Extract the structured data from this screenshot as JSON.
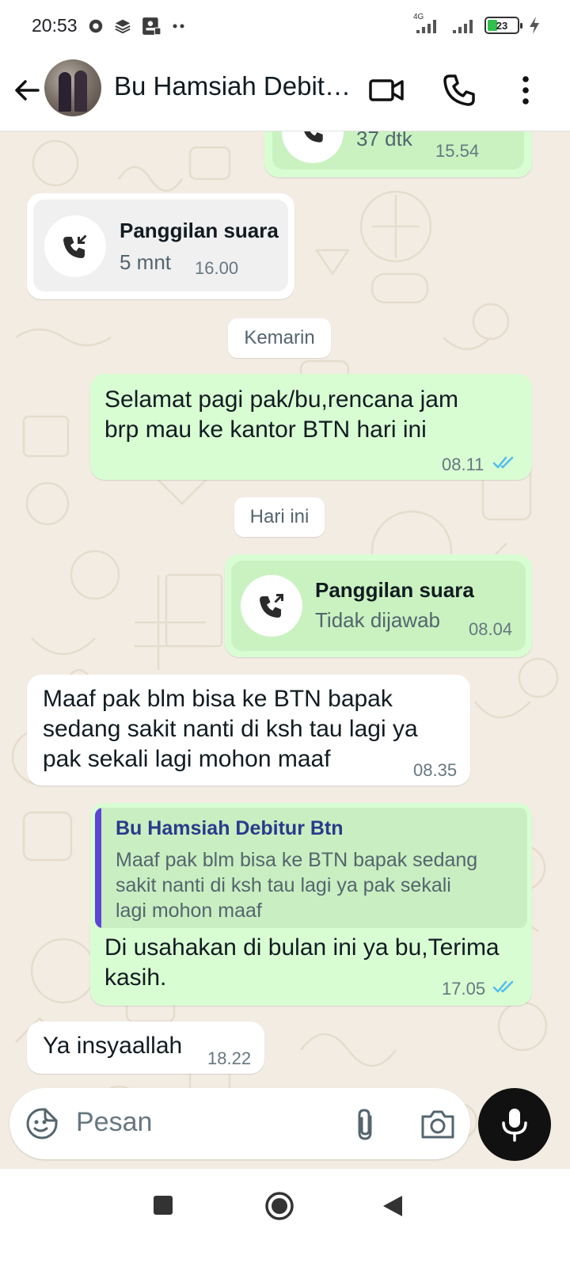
{
  "status_bar": {
    "time": "20:53",
    "network": "4G",
    "battery": "23"
  },
  "header": {
    "contact_name": "Bu Hamsiah Debit…",
    "icons": [
      "back-arrow-icon",
      "video-call-icon",
      "voice-call-icon",
      "more-vert-icon"
    ]
  },
  "messages": {
    "m0": {
      "duration": "37 dtk",
      "time": "15.54"
    },
    "m1": {
      "title": "Panggilan suara",
      "subtitle": "5 mnt",
      "time": "16.00"
    },
    "date1": "Kemarin",
    "m2": {
      "line1": "Selamat pagi pak/bu,rencana jam",
      "line2": "brp mau ke kantor BTN hari ini",
      "time": "08.11"
    },
    "date2": "Hari ini",
    "m3": {
      "title": "Panggilan suara",
      "subtitle": "Tidak dijawab",
      "time": "08.04"
    },
    "m4": {
      "line1": "Maaf pak blm bisa ke BTN bapak",
      "line2": "sedang sakit nanti di ksh tau lagi ya",
      "line3": "pak sekali lagi mohon maaf",
      "time": "08.35"
    },
    "m5": {
      "quote_author": "Bu Hamsiah Debitur Btn",
      "quote_line1": "Maaf pak blm bisa ke BTN bapak sedang",
      "quote_line2": "sakit nanti di ksh tau lagi ya pak sekali",
      "quote_line3": "lagi mohon maaf",
      "line1": "Di usahakan di bulan ini ya bu,Terima",
      "line2": "kasih.",
      "time": "17.05"
    },
    "m6": {
      "text": "Ya insyaallah",
      "time": "18.22"
    }
  },
  "composer": {
    "placeholder": "Pesan"
  },
  "colors": {
    "outgoing_bubble": "#d9fdd3",
    "incoming_bubble": "#ffffff",
    "chat_background": "#f2ece3",
    "read_ticks": "#53bdeb",
    "reply_bar": "#5d45d6"
  }
}
